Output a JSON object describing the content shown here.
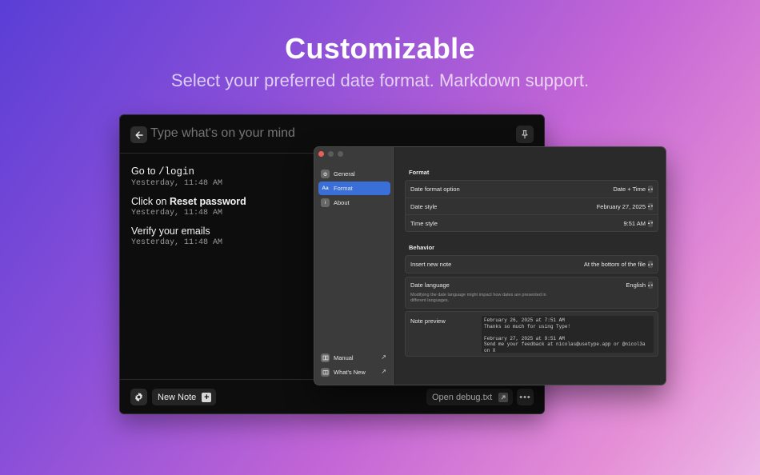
{
  "hero": {
    "title": "Customizable",
    "subtitle": "Select your preferred date format. Markdown support."
  },
  "note_window": {
    "input_placeholder": "Type what's on your mind",
    "back_icon": "arrow-left-icon",
    "pin_icon": "pin-icon",
    "notes": [
      {
        "prefix": "Go to ",
        "code": "/login",
        "bold": "",
        "time": "Yesterday, 11:48 AM"
      },
      {
        "prefix": "Click on ",
        "code": "",
        "bold": "Reset password",
        "time": "Yesterday, 11:48 AM"
      },
      {
        "prefix": "Verify your emails",
        "code": "",
        "bold": "",
        "time": "Yesterday, 11:48 AM"
      }
    ],
    "footer": {
      "new_note_label": "New Note",
      "debug_label": "Open debug.txt",
      "more_label": "•••"
    }
  },
  "settings": {
    "sidebar": {
      "items": [
        {
          "label": "General",
          "icon": "gear-icon",
          "active": false
        },
        {
          "label": "Format",
          "icon": "Aa",
          "active": true
        },
        {
          "label": "About",
          "icon": "info-icon",
          "active": false
        }
      ],
      "links": [
        {
          "label": "Manual",
          "icon": "book-icon"
        },
        {
          "label": "What's New",
          "icon": "gift-icon"
        }
      ]
    },
    "format": {
      "title": "Format",
      "rows": [
        {
          "label": "Date format option",
          "value": "Date + Time"
        },
        {
          "label": "Date style",
          "value": "February 27, 2025"
        },
        {
          "label": "Time style",
          "value": "9:51 AM"
        }
      ]
    },
    "behavior": {
      "title": "Behavior",
      "insert_label": "Insert new note",
      "insert_value": "At the bottom of the file",
      "language_label": "Date language",
      "language_value": "English",
      "language_help": "Modifying the date language might impact how dates are presented in different languages."
    },
    "preview": {
      "label": "Note preview",
      "text": "February 26, 2025 at 7:51 AM\nThanks so much for using Type!\n\nFebruary 27, 2025 at 9:51 AM\nSend me your feedback at nicolas@usetype.app or @nicol3a\non X"
    }
  },
  "colors": {
    "accent": "#3a6fd8",
    "traffic_red": "#ec5f56",
    "traffic_gray": "#5c5c5c"
  }
}
